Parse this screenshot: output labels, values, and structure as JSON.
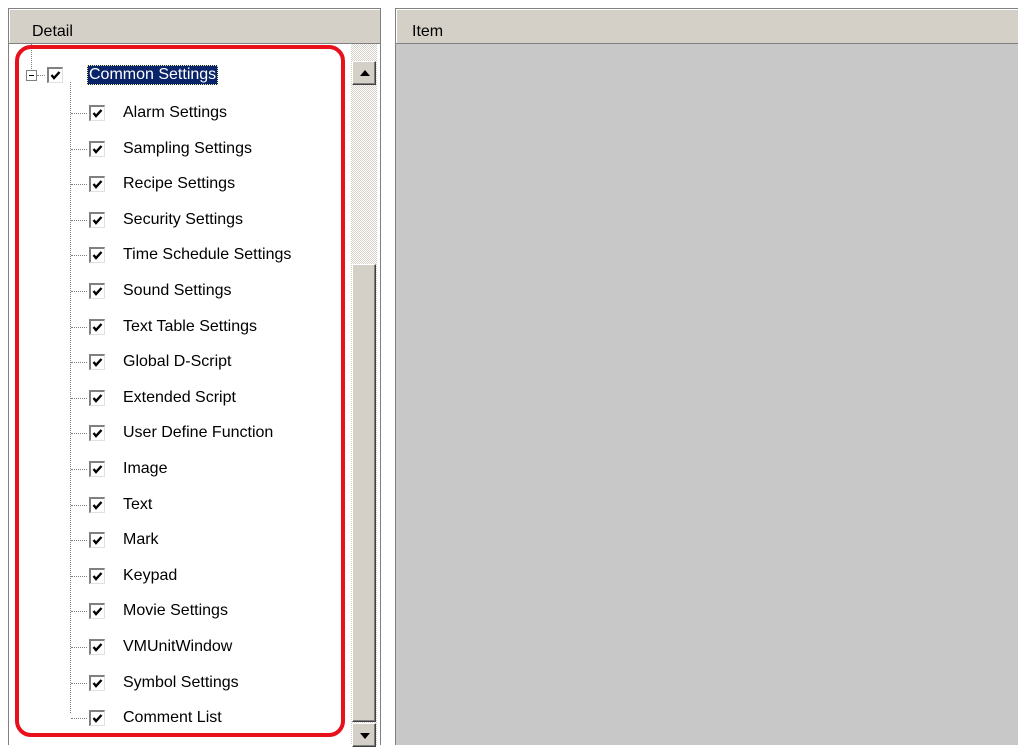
{
  "left_panel": {
    "header": "Detail",
    "root": {
      "label": "Common Settings",
      "checked": true,
      "expanded": true
    },
    "items": [
      {
        "label": "Alarm Settings",
        "checked": true
      },
      {
        "label": "Sampling Settings",
        "checked": true
      },
      {
        "label": "Recipe Settings",
        "checked": true
      },
      {
        "label": "Security Settings",
        "checked": true
      },
      {
        "label": "Time Schedule Settings",
        "checked": true
      },
      {
        "label": "Sound Settings",
        "checked": true
      },
      {
        "label": "Text Table Settings",
        "checked": true
      },
      {
        "label": "Global D-Script",
        "checked": true
      },
      {
        "label": "Extended Script",
        "checked": true
      },
      {
        "label": "User Define Function",
        "checked": true
      },
      {
        "label": "Image",
        "checked": true
      },
      {
        "label": "Text",
        "checked": true
      },
      {
        "label": "Mark",
        "checked": true
      },
      {
        "label": "Keypad",
        "checked": true
      },
      {
        "label": "Movie Settings",
        "checked": true
      },
      {
        "label": "VMUnitWindow",
        "checked": true
      },
      {
        "label": "Symbol Settings",
        "checked": true
      },
      {
        "label": "Comment List",
        "checked": true
      }
    ]
  },
  "right_panel": {
    "header": "Item"
  },
  "colors": {
    "selection": "#0a246a",
    "highlight_border": "#e8101a",
    "panel_bg": "#c8c8c8",
    "header_bg": "#d4d0c8"
  }
}
